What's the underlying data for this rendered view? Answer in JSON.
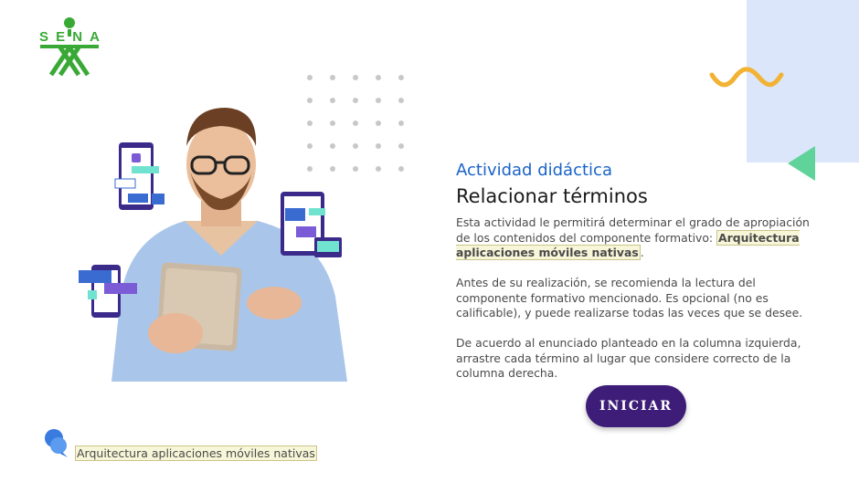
{
  "logo": {
    "text": "SENA",
    "color": "#39a935"
  },
  "activity": {
    "subtitle": "Actividad didáctica",
    "title": "Relacionar términos"
  },
  "paragraph1": {
    "before": "Esta actividad le permitirá determinar el grado de apropiación de los contenidos del componente formativo: ",
    "highlight": "Arquitectura aplicaciones móviles nativas",
    "after": "."
  },
  "paragraph2": "Antes de su realización, se recomienda la lectura del componente formativo mencionado.  Es opcional (no es calificable), y puede realizarse todas las veces que se desee.",
  "paragraph3": "De acuerdo al enunciado planteado en la columna izquierda, arrastre cada término al lugar que considere correcto de la columna derecha.",
  "start_button": {
    "label": "INICIAR"
  },
  "footer": {
    "label": "Arquitectura aplicaciones móviles nativas",
    "icon": "chat-bubbles-icon"
  },
  "colors": {
    "accent_blue": "#1a63c8",
    "button": "#3d1d77",
    "panel_blue": "#dbe6fb",
    "triangle_green": "#5fd39a",
    "squiggle_yellow": "#f2b233"
  }
}
